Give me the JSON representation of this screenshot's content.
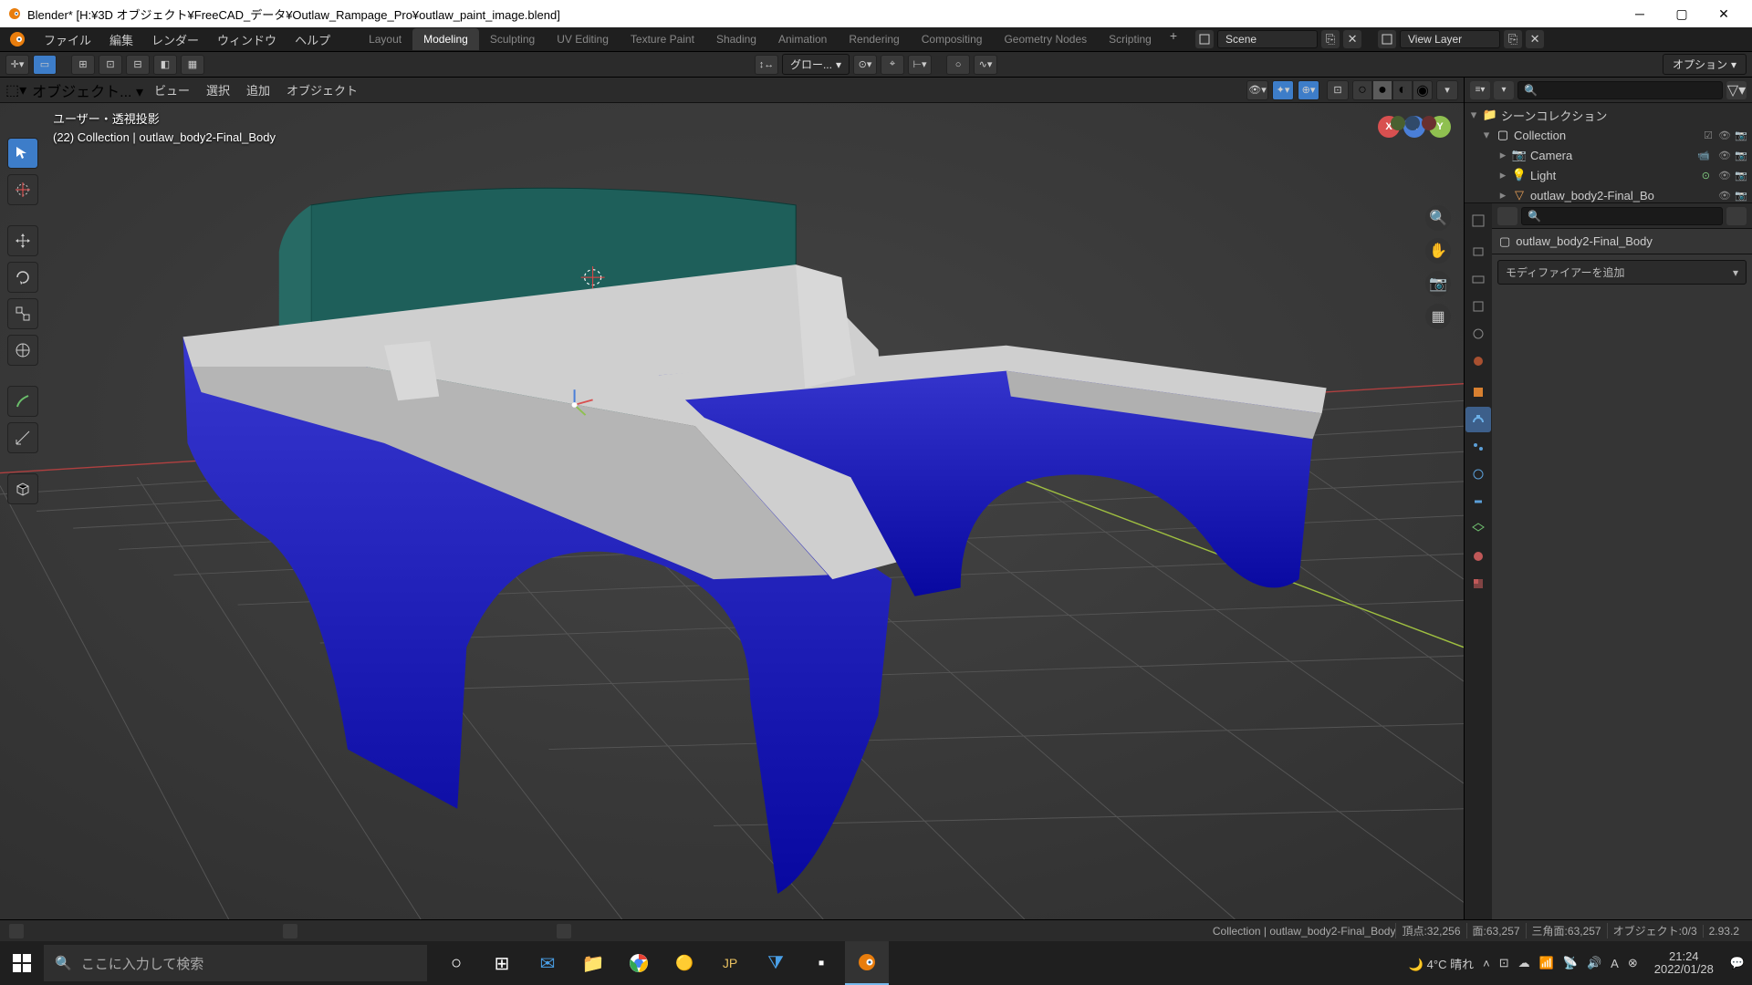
{
  "window": {
    "title": "Blender* [H:¥3D オブジェクト¥FreeCAD_データ¥Outlaw_Rampage_Pro¥outlaw_paint_image.blend]"
  },
  "menu": {
    "items": [
      "ファイル",
      "編集",
      "レンダー",
      "ウィンドウ",
      "ヘルプ"
    ]
  },
  "workspaces": {
    "tabs": [
      "Layout",
      "Modeling",
      "Sculpting",
      "UV Editing",
      "Texture Paint",
      "Shading",
      "Animation",
      "Rendering",
      "Compositing",
      "Geometry Nodes",
      "Scripting"
    ],
    "active": "Modeling"
  },
  "scene": {
    "name": "Scene",
    "layer": "View Layer"
  },
  "viewport_header": {
    "mode": "オブジェクト...",
    "menus": [
      "ビュー",
      "選択",
      "追加",
      "オブジェクト"
    ],
    "orientation": "グロー...",
    "options": "オプション"
  },
  "viewport_overlay": {
    "line1": "ユーザー・透視投影",
    "line2": "(22) Collection | outlaw_body2-Final_Body"
  },
  "outliner": {
    "root": "シーンコレクション",
    "collection": "Collection",
    "items": [
      {
        "name": "Camera",
        "icon": "camera"
      },
      {
        "name": "Light",
        "icon": "light"
      },
      {
        "name": "outlaw_body2-Final_Bo",
        "icon": "mesh"
      }
    ]
  },
  "properties": {
    "context_object": "outlaw_body2-Final_Body",
    "modifier_add": "モディファイアーを追加"
  },
  "statusbar": {
    "context": "Collection | outlaw_body2-Final_Body",
    "verts_label": "頂点:",
    "verts": "32,256",
    "faces_label": "面:",
    "faces": "63,257",
    "tris_label": "三角面:",
    "tris": "63,257",
    "objects_label": "オブジェクト:",
    "objects": "0/3",
    "version": "2.93.2"
  },
  "taskbar": {
    "search_placeholder": "ここに入力して検索",
    "weather": "4°C 晴れ",
    "time": "21:24",
    "date": "2022/01/28"
  }
}
